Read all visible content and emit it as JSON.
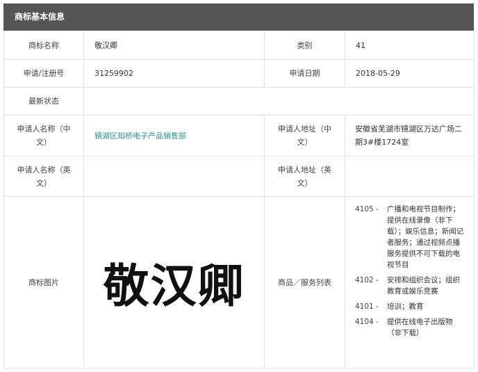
{
  "header": {
    "title": "商标基本信息"
  },
  "rows": {
    "r1": {
      "label_a": "商标名称",
      "value_a": "敬汉卿",
      "label_b": "类别",
      "value_b": "41"
    },
    "r2": {
      "label_a": "申请/注册号",
      "value_a": "31259902",
      "label_b": "申请日期",
      "value_b": "2018-05-29"
    },
    "r3": {
      "label_a": "最新状态",
      "value_a": ""
    },
    "r4": {
      "label_a": "申请人名称（中文）",
      "value_a": "镜湖区知桥电子产品销售部",
      "label_b": "申请人地址（中文）",
      "value_b": "安徽省芜湖市镜湖区万达广场二期3#楼1724室"
    },
    "r5": {
      "label_a": "申请人名称（英文）",
      "value_a": "",
      "label_b": "申请人地址（英文）",
      "value_b": ""
    },
    "r6": {
      "label_a": "商标图片",
      "mark_text": "敬汉卿",
      "label_b": "商品／服务列表"
    }
  },
  "services": [
    {
      "code": "4105 -",
      "text": "广播和电视节目制作；提供在线录像（非下载）；娱乐信息；新闻记者服务；通过视频点播服务提供不可下载的电视节目"
    },
    {
      "code": "4102 -",
      "text": "安排和组织会议；组织教育或娱乐竞赛"
    },
    {
      "code": "4101 -",
      "text": "培训；教育"
    },
    {
      "code": "4104 -",
      "text": "提供在线电子出版物（非下载）"
    }
  ],
  "colors": {
    "header_bg": "#555555",
    "link": "#2a9a8f",
    "border": "#e3e3e3"
  }
}
